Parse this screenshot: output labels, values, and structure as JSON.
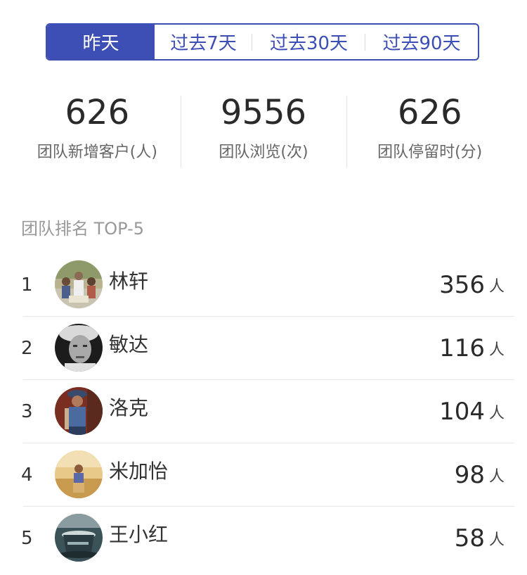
{
  "tabs": [
    {
      "label": "昨天",
      "active": true
    },
    {
      "label": "过去7天",
      "active": false
    },
    {
      "label": "过去30天",
      "active": false
    },
    {
      "label": "过去90天",
      "active": false
    }
  ],
  "colors": {
    "accent": "#3d4fb5"
  },
  "stats": [
    {
      "value": "626",
      "label": "团队新增客户(人)"
    },
    {
      "value": "9556",
      "label": "团队浏览(次)"
    },
    {
      "value": "626",
      "label": "团队停留时(分)"
    }
  ],
  "ranking": {
    "title": "团队排名 TOP-5",
    "unit": "人",
    "rows": [
      {
        "rank": "1",
        "name": "林轩",
        "value": "356",
        "avatar": "group-photo-avatar"
      },
      {
        "rank": "2",
        "name": "敏达",
        "value": "116",
        "avatar": "old-man-avatar"
      },
      {
        "rank": "3",
        "name": "洛克",
        "value": "104",
        "avatar": "farmer-avatar"
      },
      {
        "rank": "4",
        "name": "米加怡",
        "value": "98",
        "avatar": "field-avatar"
      },
      {
        "rank": "5",
        "name": "王小红",
        "value": "58",
        "avatar": "coffee-cup-avatar"
      }
    ]
  }
}
